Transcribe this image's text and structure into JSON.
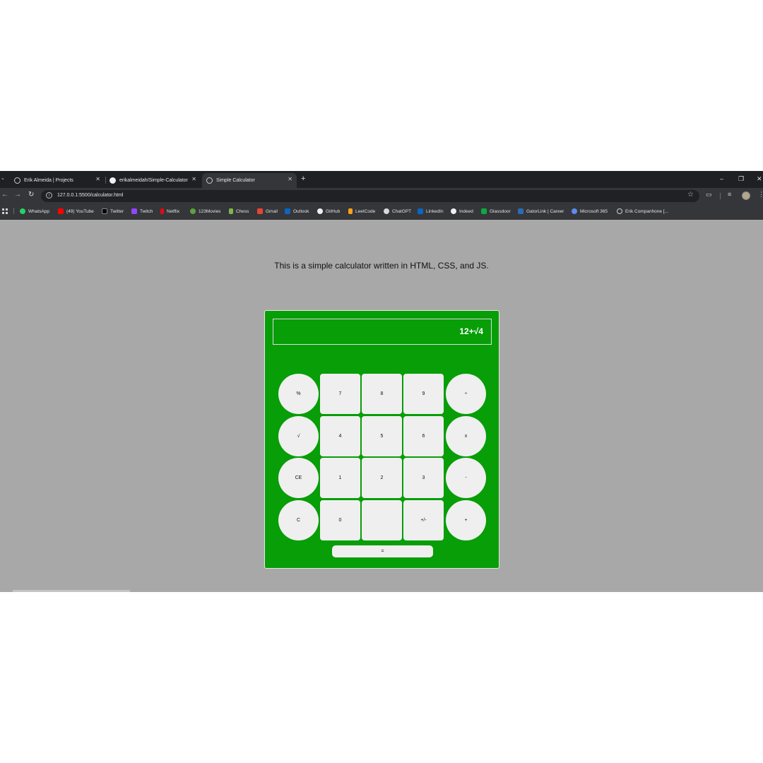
{
  "tabs": [
    {
      "title": "Erik Almeida | Projects",
      "active": false
    },
    {
      "title": "erikalmeidah/Simple-Calculator",
      "active": false
    },
    {
      "title": "Simple Calculator",
      "active": true
    }
  ],
  "toolbar": {
    "url": "127.0.0.1:5500/calculator.html"
  },
  "bookmarks": [
    {
      "label": "WhatsApp",
      "icon": "whatsapp-icon",
      "color": "#25d366"
    },
    {
      "label": "(49) YouTube",
      "icon": "youtube-icon",
      "color": "#ff0000"
    },
    {
      "label": "Twitter",
      "icon": "x-icon",
      "color": "#000000"
    },
    {
      "label": "Twitch",
      "icon": "twitch-icon",
      "color": "#9146ff"
    },
    {
      "label": "Netflix",
      "icon": "netflix-icon",
      "color": "#e50914"
    },
    {
      "label": "123Movies",
      "icon": "play-icon",
      "color": "#5aa33f"
    },
    {
      "label": "Chess",
      "icon": "pawn-icon",
      "color": "#81b64c"
    },
    {
      "label": "Gmail",
      "icon": "gmail-icon",
      "color": "#ea4335"
    },
    {
      "label": "Outlook",
      "icon": "outlook-icon",
      "color": "#0a66c2"
    },
    {
      "label": "GitHub",
      "icon": "github-icon",
      "color": "#f0f0f0"
    },
    {
      "label": "LeetCode",
      "icon": "leetcode-icon",
      "color": "#ffa116"
    },
    {
      "label": "ChatGPT",
      "icon": "chatgpt-icon",
      "color": "#d9d9d9"
    },
    {
      "label": "LinkedIn",
      "icon": "linkedin-icon",
      "color": "#0a66c2"
    },
    {
      "label": "Indeed",
      "icon": "indeed-icon",
      "color": "#f0f0f0"
    },
    {
      "label": "Glassdoor",
      "icon": "glassdoor-icon",
      "color": "#0caa41"
    },
    {
      "label": "GatorLink | Career",
      "icon": "gatorlink-icon",
      "color": "#2b6cb0"
    },
    {
      "label": "Microsoft 365",
      "icon": "microsoft-icon",
      "color": "#5b8def"
    },
    {
      "label": "Erik Companhone [...",
      "icon": "globe-icon",
      "color": "#cfcfcf"
    }
  ],
  "page": {
    "intro": "This is a simple calculator written in HTML, CSS, and JS.",
    "background": "#a8a8a8"
  },
  "calculator": {
    "display": "12+√4",
    "accent": "#079e07",
    "keys": {
      "percent": "%",
      "k7": "7",
      "k8": "8",
      "k9": "9",
      "divide": "÷",
      "sqrt": "√",
      "k4": "4",
      "k5": "5",
      "k6": "6",
      "multiply": "x",
      "clear_entry": "CE",
      "k1": "1",
      "k2": "2",
      "k3": "3",
      "minus": "-",
      "clear": "C",
      "k0": "0",
      "decimal": ".",
      "negate": "+/-",
      "plus": "+",
      "equals": "="
    }
  }
}
